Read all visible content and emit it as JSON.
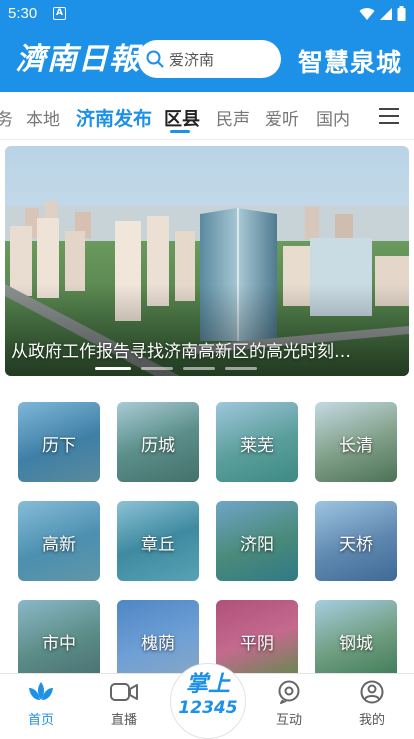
{
  "statusbar": {
    "time": "5:30",
    "notif_icon_letter": "A"
  },
  "header": {
    "logo_text": "濟南日報",
    "search_placeholder": "爱济南",
    "brand_right": "智慧泉城"
  },
  "tabs": [
    "务",
    "本地",
    "济南发布",
    "区县",
    "民声",
    "爱听",
    "国内"
  ],
  "active_tab": "区县",
  "banner": {
    "caption": "从政府工作报告寻找济南高新区的高光时刻…",
    "slide_count": 4,
    "active_slide": 1
  },
  "districts": [
    "历下",
    "历城",
    "莱芜",
    "长清",
    "高新",
    "章丘",
    "济阳",
    "天桥",
    "市中",
    "槐荫",
    "平阴",
    "钢城"
  ],
  "bottom_nav": {
    "items": [
      {
        "label": "首页",
        "icon": "home-lotus-icon"
      },
      {
        "label": "直播",
        "icon": "video-camera-icon"
      },
      {
        "label": "互动",
        "icon": "chat-bubble-icon"
      },
      {
        "label": "我的",
        "icon": "profile-icon"
      }
    ],
    "center_top": "掌上",
    "center_num": "12345"
  },
  "colors": {
    "accent": "#1d90e8"
  }
}
